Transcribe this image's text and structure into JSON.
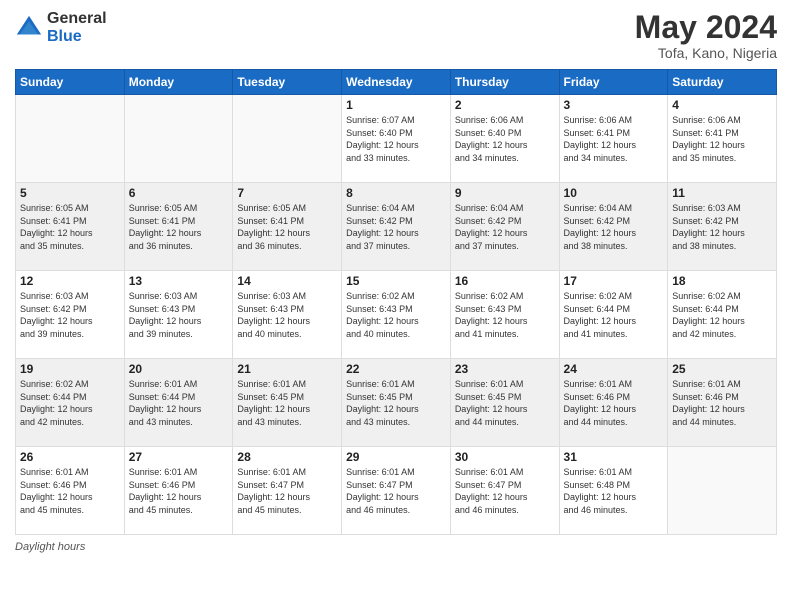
{
  "header": {
    "logo_line1": "General",
    "logo_line2": "Blue",
    "main_title": "May 2024",
    "subtitle": "Tofa, Kano, Nigeria"
  },
  "days_of_week": [
    "Sunday",
    "Monday",
    "Tuesday",
    "Wednesday",
    "Thursday",
    "Friday",
    "Saturday"
  ],
  "weeks": [
    [
      {
        "day": "",
        "content": ""
      },
      {
        "day": "",
        "content": ""
      },
      {
        "day": "",
        "content": ""
      },
      {
        "day": "1",
        "content": "Sunrise: 6:07 AM\nSunset: 6:40 PM\nDaylight: 12 hours\nand 33 minutes."
      },
      {
        "day": "2",
        "content": "Sunrise: 6:06 AM\nSunset: 6:40 PM\nDaylight: 12 hours\nand 34 minutes."
      },
      {
        "day": "3",
        "content": "Sunrise: 6:06 AM\nSunset: 6:41 PM\nDaylight: 12 hours\nand 34 minutes."
      },
      {
        "day": "4",
        "content": "Sunrise: 6:06 AM\nSunset: 6:41 PM\nDaylight: 12 hours\nand 35 minutes."
      }
    ],
    [
      {
        "day": "5",
        "content": "Sunrise: 6:05 AM\nSunset: 6:41 PM\nDaylight: 12 hours\nand 35 minutes."
      },
      {
        "day": "6",
        "content": "Sunrise: 6:05 AM\nSunset: 6:41 PM\nDaylight: 12 hours\nand 36 minutes."
      },
      {
        "day": "7",
        "content": "Sunrise: 6:05 AM\nSunset: 6:41 PM\nDaylight: 12 hours\nand 36 minutes."
      },
      {
        "day": "8",
        "content": "Sunrise: 6:04 AM\nSunset: 6:42 PM\nDaylight: 12 hours\nand 37 minutes."
      },
      {
        "day": "9",
        "content": "Sunrise: 6:04 AM\nSunset: 6:42 PM\nDaylight: 12 hours\nand 37 minutes."
      },
      {
        "day": "10",
        "content": "Sunrise: 6:04 AM\nSunset: 6:42 PM\nDaylight: 12 hours\nand 38 minutes."
      },
      {
        "day": "11",
        "content": "Sunrise: 6:03 AM\nSunset: 6:42 PM\nDaylight: 12 hours\nand 38 minutes."
      }
    ],
    [
      {
        "day": "12",
        "content": "Sunrise: 6:03 AM\nSunset: 6:42 PM\nDaylight: 12 hours\nand 39 minutes."
      },
      {
        "day": "13",
        "content": "Sunrise: 6:03 AM\nSunset: 6:43 PM\nDaylight: 12 hours\nand 39 minutes."
      },
      {
        "day": "14",
        "content": "Sunrise: 6:03 AM\nSunset: 6:43 PM\nDaylight: 12 hours\nand 40 minutes."
      },
      {
        "day": "15",
        "content": "Sunrise: 6:02 AM\nSunset: 6:43 PM\nDaylight: 12 hours\nand 40 minutes."
      },
      {
        "day": "16",
        "content": "Sunrise: 6:02 AM\nSunset: 6:43 PM\nDaylight: 12 hours\nand 41 minutes."
      },
      {
        "day": "17",
        "content": "Sunrise: 6:02 AM\nSunset: 6:44 PM\nDaylight: 12 hours\nand 41 minutes."
      },
      {
        "day": "18",
        "content": "Sunrise: 6:02 AM\nSunset: 6:44 PM\nDaylight: 12 hours\nand 42 minutes."
      }
    ],
    [
      {
        "day": "19",
        "content": "Sunrise: 6:02 AM\nSunset: 6:44 PM\nDaylight: 12 hours\nand 42 minutes."
      },
      {
        "day": "20",
        "content": "Sunrise: 6:01 AM\nSunset: 6:44 PM\nDaylight: 12 hours\nand 43 minutes."
      },
      {
        "day": "21",
        "content": "Sunrise: 6:01 AM\nSunset: 6:45 PM\nDaylight: 12 hours\nand 43 minutes."
      },
      {
        "day": "22",
        "content": "Sunrise: 6:01 AM\nSunset: 6:45 PM\nDaylight: 12 hours\nand 43 minutes."
      },
      {
        "day": "23",
        "content": "Sunrise: 6:01 AM\nSunset: 6:45 PM\nDaylight: 12 hours\nand 44 minutes."
      },
      {
        "day": "24",
        "content": "Sunrise: 6:01 AM\nSunset: 6:46 PM\nDaylight: 12 hours\nand 44 minutes."
      },
      {
        "day": "25",
        "content": "Sunrise: 6:01 AM\nSunset: 6:46 PM\nDaylight: 12 hours\nand 44 minutes."
      }
    ],
    [
      {
        "day": "26",
        "content": "Sunrise: 6:01 AM\nSunset: 6:46 PM\nDaylight: 12 hours\nand 45 minutes."
      },
      {
        "day": "27",
        "content": "Sunrise: 6:01 AM\nSunset: 6:46 PM\nDaylight: 12 hours\nand 45 minutes."
      },
      {
        "day": "28",
        "content": "Sunrise: 6:01 AM\nSunset: 6:47 PM\nDaylight: 12 hours\nand 45 minutes."
      },
      {
        "day": "29",
        "content": "Sunrise: 6:01 AM\nSunset: 6:47 PM\nDaylight: 12 hours\nand 46 minutes."
      },
      {
        "day": "30",
        "content": "Sunrise: 6:01 AM\nSunset: 6:47 PM\nDaylight: 12 hours\nand 46 minutes."
      },
      {
        "day": "31",
        "content": "Sunrise: 6:01 AM\nSunset: 6:48 PM\nDaylight: 12 hours\nand 46 minutes."
      },
      {
        "day": "",
        "content": ""
      }
    ]
  ],
  "footer": {
    "label": "Daylight hours"
  }
}
